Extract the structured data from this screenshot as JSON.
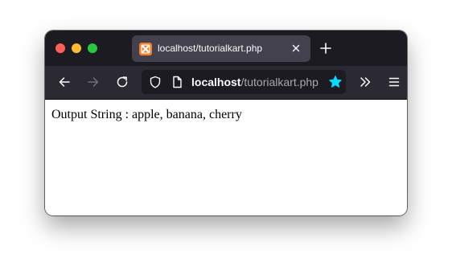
{
  "browser": {
    "tab": {
      "title": "localhost/tutorialkart.php",
      "favicon": "xampp-favicon-icon"
    },
    "url": {
      "host": "localhost",
      "path": "/tutorialkart.php"
    },
    "icons": [
      "close-tab-icon",
      "new-tab-icon",
      "back-arrow-icon",
      "forward-arrow-icon",
      "reload-icon",
      "shield-icon",
      "page-icon",
      "bookmark-star-icon",
      "overflow-chevrons-icon",
      "hamburger-menu-icon"
    ],
    "colors": {
      "titlebar": "#1c1b22",
      "tab": "#42414d",
      "navbar": "#2b2a33",
      "star": "#00ddff",
      "traffic_close": "#ff5f57",
      "traffic_min": "#febc2e",
      "traffic_max": "#28c840"
    }
  },
  "page": {
    "output_text": "Output String : apple, banana, cherry"
  }
}
